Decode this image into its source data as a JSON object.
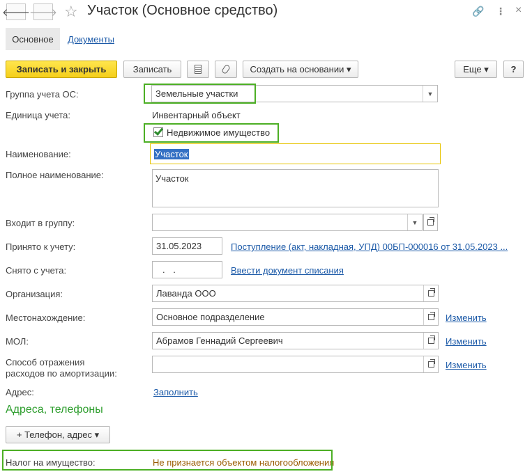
{
  "header": {
    "title": "Участок (Основное средство)",
    "back_glyph": "🡐",
    "forward_glyph": "🡒",
    "star_glyph": "☆",
    "link_glyph": "🔗",
    "menu_glyph": "⋮",
    "close_glyph": "×"
  },
  "tabs": [
    {
      "label": "Основное"
    },
    {
      "label": "Документы"
    }
  ],
  "toolbar": {
    "save_close": "Записать и закрыть",
    "save": "Записать",
    "create_based": "Создать на основании ▾",
    "more": "Еще ▾",
    "help": "?"
  },
  "form": {
    "group_label": "Группа учета ОС:",
    "group_value": "Земельные участки",
    "unit_label": "Единица учета:",
    "unit_value": "Инвентарный объект",
    "realty_label": "Недвижимое имущество",
    "name_label": "Наименование:",
    "name_value": "Участок",
    "fullname_label": "Полное наименование:",
    "fullname_value": "Участок",
    "parent_label": "Входит в группу:",
    "parent_value": "",
    "accepted_label": "Принято к учету:",
    "accepted_value": "31.05.2023",
    "accepted_link": "Поступление (акт, накладная, УПД) 00БП-000016 от 31.05.2023 ...",
    "removed_label": "Снято с учета:",
    "removed_value": ".  .",
    "removed_link": "Ввести документ списания",
    "org_label": "Организация:",
    "org_value": "Лаванда ООО",
    "location_label": "Местонахождение:",
    "location_value": "Основное подразделение",
    "location_change": "Изменить",
    "mol_label": "МОЛ:",
    "mol_value": "Абрамов Геннадий Сергеевич",
    "mol_change": "Изменить",
    "depr_label_1": "Способ отражения",
    "depr_label_2": "расходов по амортизации:",
    "depr_value": "",
    "depr_change": "Изменить",
    "address_label": "Адрес:",
    "address_link": "Заполнить"
  },
  "contacts": {
    "section_title": "Адреса, телефоны",
    "add_button": "+ Телефон, адрес ▾"
  },
  "tax": {
    "label": "Налог на имущество:",
    "value": "Не признается объектом налогообложения"
  },
  "colors": {
    "accent_green": "#4caf24",
    "primary_yellow": "#f5cf1a",
    "link_blue": "#1c5aa8",
    "tax_value": "#9a5b00"
  }
}
